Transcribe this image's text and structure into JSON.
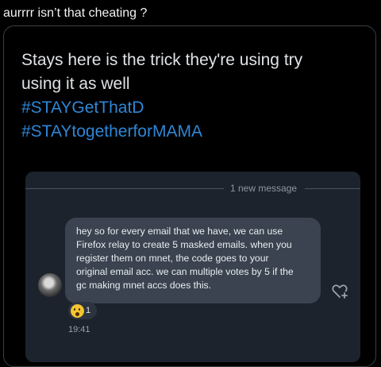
{
  "tweet": {
    "text": "aurrrr isn’t that cheating ?"
  },
  "quote": {
    "lines": [
      "Stays here is the trick they're using try",
      "using it as well"
    ],
    "hashtags": [
      "#STAYGetThatD",
      "#STAYtogetherforMAMA"
    ]
  },
  "chat_screenshot": {
    "divider_label": "1 new message",
    "message_lines": [
      "hey so for every email that we have, we can use",
      "Firefox relay to create 5 masked emails. when you",
      "register them on mnet, the code goes to your",
      "original email acc. we can multiple votes by 5 if the",
      "gc making mnet accs does this."
    ],
    "reaction": {
      "emoji": "astonished-face",
      "count": "1"
    },
    "timestamp": "19:41",
    "icons": {
      "react": "add-reaction-icon"
    }
  },
  "colors": {
    "background": "#000000",
    "hashtag": "#2f86d6",
    "bubble": "#3a434f",
    "panel": "#1c232d"
  }
}
